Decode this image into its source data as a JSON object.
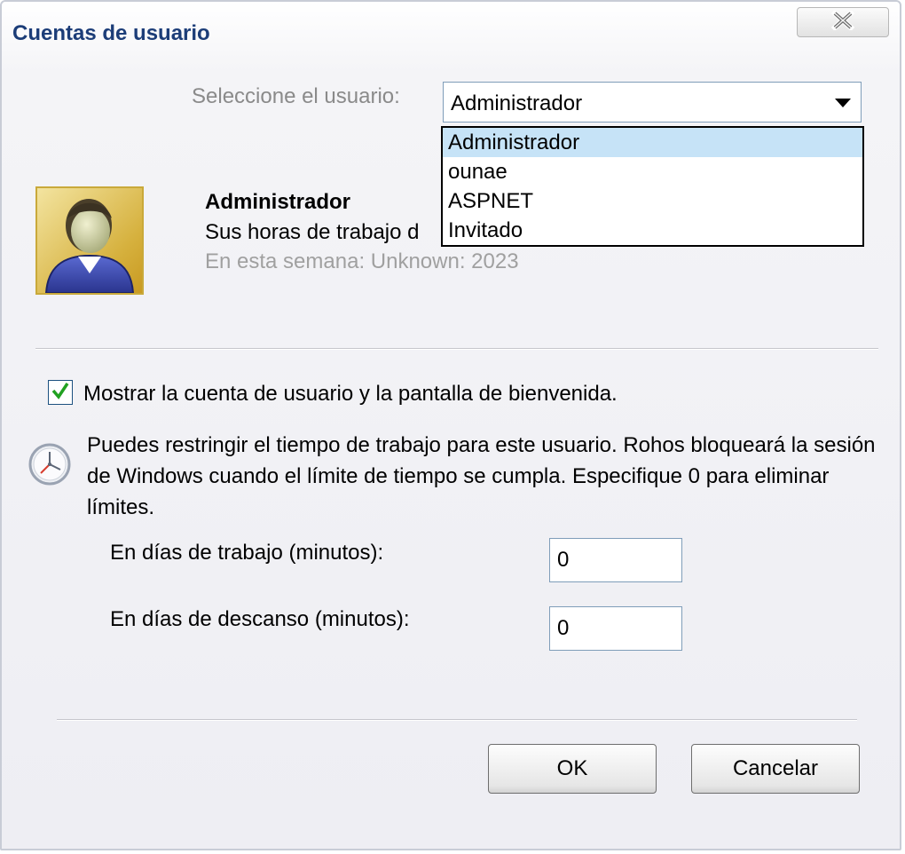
{
  "window": {
    "title": "Cuentas de usuario",
    "close_icon": "close-x-icon"
  },
  "user_select": {
    "label": "Seleccione el usuario:",
    "selected": "Administrador",
    "options": [
      "Administrador",
      "ounae",
      "ASPNET",
      "Invitado"
    ],
    "highlight_color": "#c6e3f7"
  },
  "user_info": {
    "avatar_icon": "user-avatar-icon",
    "name": "Administrador",
    "work_hours": "Sus horas de trabajo d",
    "week": "En esta semana: Unknown: 2023"
  },
  "welcome_checkbox": {
    "checked": true,
    "label": "Mostrar la cuenta de usuario y la pantalla de bienvenida."
  },
  "restriction": {
    "icon": "clock-icon",
    "text": "Puedes restringir el tiempo de trabajo para este usuario. Rohos bloqueará la sesión de Windows cuando el límite de tiempo se cumpla. Especifique 0 para eliminar límites.",
    "work_days_label": "En días de trabajo (minutos):",
    "work_days_value": "0",
    "rest_days_label": "En días de descanso (minutos):",
    "rest_days_value": "0"
  },
  "buttons": {
    "ok": "OK",
    "cancel": "Cancelar"
  },
  "colors": {
    "title": "#1c3d78",
    "muted_text": "#a0a0a0"
  }
}
